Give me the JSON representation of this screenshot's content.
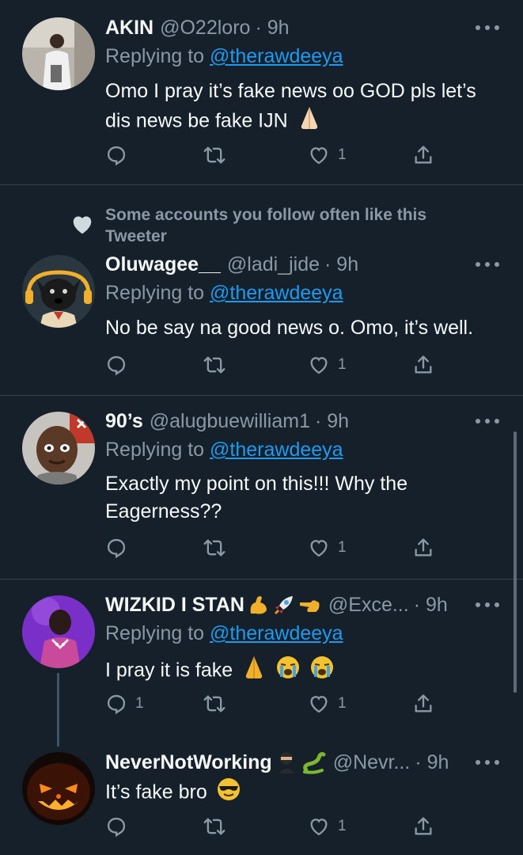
{
  "tweets": [
    {
      "name": "AKIN",
      "handle": "@O22loro",
      "time": "· 9h",
      "replying_prefix": "Replying to",
      "replying_to": "@therawdeeya",
      "text": "Omo I pray it’s fake news oo GOD pls let’s dis news be fake IJN",
      "replies": "",
      "retweets": "",
      "likes": "1"
    },
    {
      "social_context": "Some accounts you follow often like this Tweeter",
      "name": "Oluwagee__",
      "handle": "@ladi_jide",
      "time": "· 9h",
      "replying_prefix": "Replying to",
      "replying_to": "@therawdeeya",
      "text": "No be say na good news o. Omo, it’s well.",
      "replies": "",
      "retweets": "",
      "likes": "1"
    },
    {
      "name": "90’s",
      "handle": "@alugbuewilliam1",
      "time": "· 9h",
      "replying_prefix": "Replying to",
      "replying_to": "@therawdeeya",
      "text": "Exactly my point on this!!! Why the Eagerness??",
      "replies": "",
      "retweets": "",
      "likes": "1"
    },
    {
      "name": "WIZKID I STAN",
      "handle": "@Exce...",
      "time": "· 9h",
      "replying_prefix": "Replying to",
      "replying_to": "@therawdeeya",
      "text": "I pray it is fake",
      "replies": "1",
      "retweets": "",
      "likes": "1"
    },
    {
      "name": "NeverNotWorking",
      "handle": "@Nevr...",
      "time": "· 9h",
      "text": "It’s fake bro",
      "replies": "",
      "retweets": "",
      "likes": "1"
    }
  ],
  "colors": {
    "background": "#15202b",
    "primary_text": "#f7f9f9",
    "secondary_text": "#8b98a5",
    "link": "#1d9bf0",
    "divider": "#38444d"
  },
  "icons": [
    "more-icon",
    "reply-icon",
    "retweet-icon",
    "like-icon",
    "share-icon",
    "heart-icon"
  ]
}
